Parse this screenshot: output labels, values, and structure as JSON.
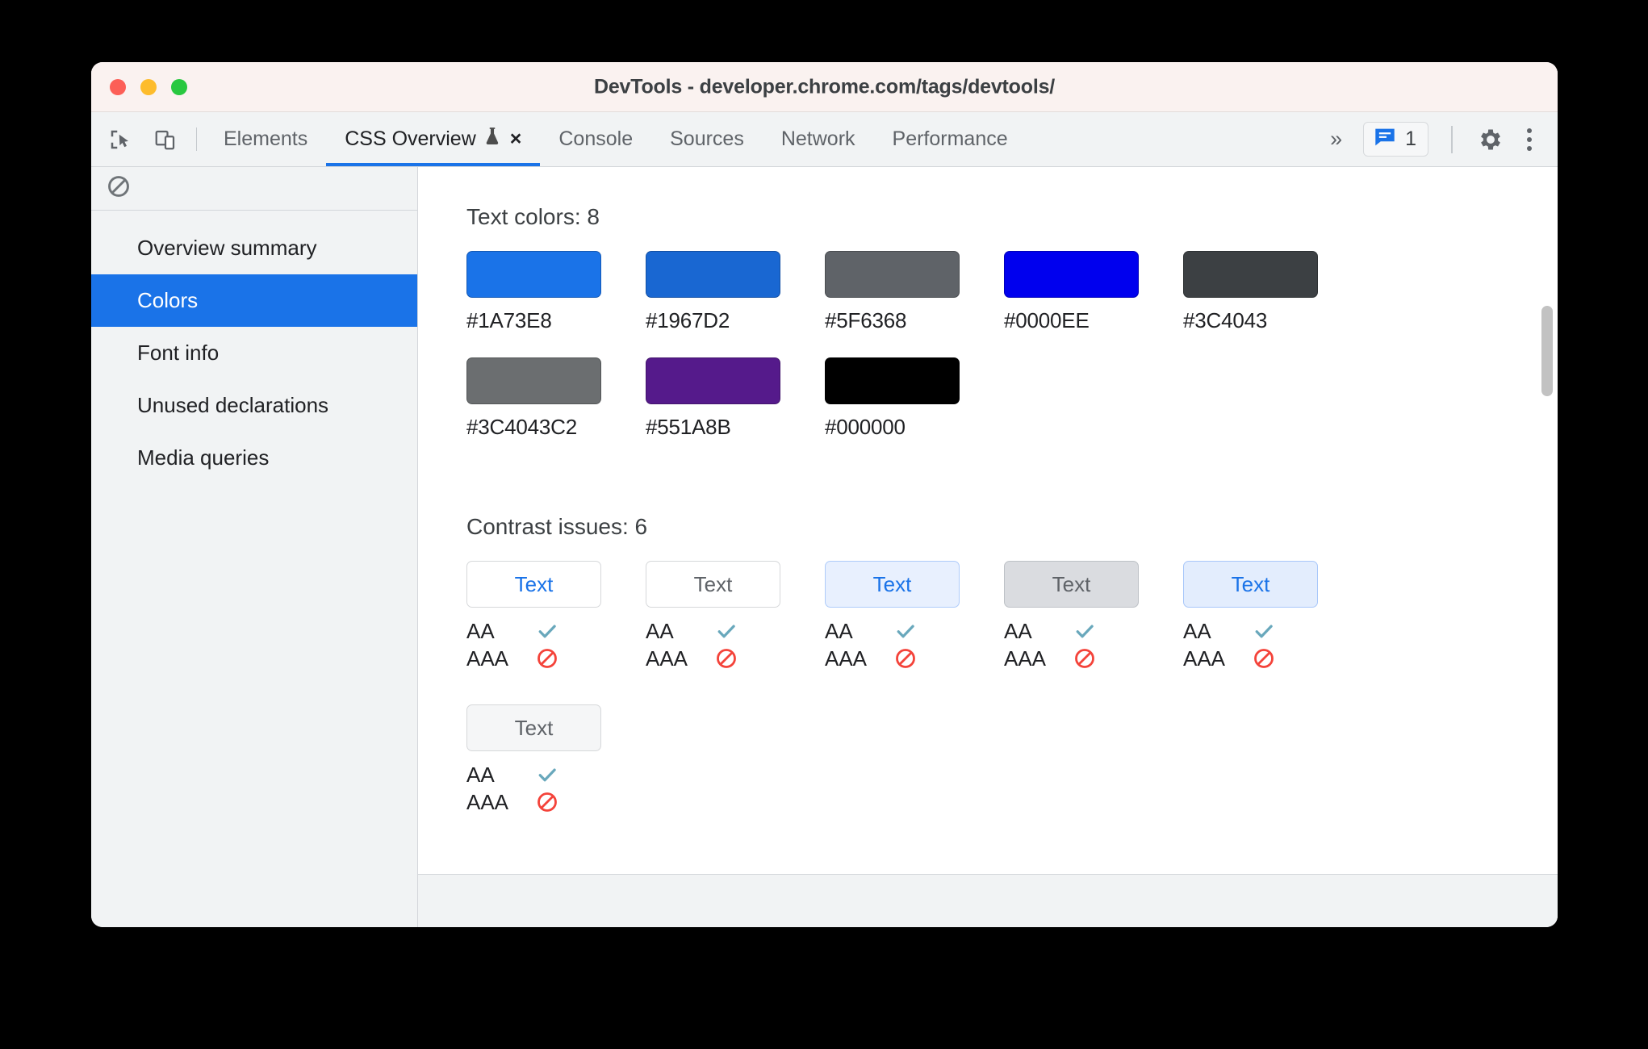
{
  "window": {
    "title": "DevTools - developer.chrome.com/tags/devtools/",
    "traffic_lights": [
      {
        "name": "close",
        "color": "#FC5F57"
      },
      {
        "name": "minimize",
        "color": "#FDBC2C"
      },
      {
        "name": "zoom",
        "color": "#28C840"
      }
    ]
  },
  "toolbar": {
    "inspect_icon": "inspect-element-icon",
    "device_icon": "device-toolbar-icon",
    "tabs": [
      {
        "label": "Elements",
        "active": false,
        "closable": false,
        "experimental": false
      },
      {
        "label": "CSS Overview",
        "active": true,
        "closable": true,
        "experimental": true,
        "close_label": "×"
      },
      {
        "label": "Console",
        "active": false,
        "closable": false,
        "experimental": false
      },
      {
        "label": "Sources",
        "active": false,
        "closable": false,
        "experimental": false
      },
      {
        "label": "Network",
        "active": false,
        "closable": false,
        "experimental": false
      },
      {
        "label": "Performance",
        "active": false,
        "closable": false,
        "experimental": false
      }
    ],
    "overflow_label": "»",
    "issues_count": "1",
    "issues_icon": "issues-message-icon",
    "settings_icon": "gear-icon",
    "menu_icon": "kebab-menu-icon",
    "active_tab_underline_color": "#1A73E8"
  },
  "sidebar": {
    "clear_icon": "clear-overview-icon",
    "items": [
      {
        "label": "Overview summary",
        "selected": false
      },
      {
        "label": "Colors",
        "selected": true
      },
      {
        "label": "Font info",
        "selected": false
      },
      {
        "label": "Unused declarations",
        "selected": false
      },
      {
        "label": "Media queries",
        "selected": false
      }
    ],
    "selected_bg": "#1A73E8"
  },
  "main": {
    "text_colors": {
      "heading": "Text colors: 8",
      "swatches": [
        {
          "label": "#1A73E8",
          "color": "#1A73E8"
        },
        {
          "label": "#1967D2",
          "color": "#1967D2"
        },
        {
          "label": "#5F6368",
          "color": "#5F6368"
        },
        {
          "label": "#0000EE",
          "color": "#0000EE"
        },
        {
          "label": "#3C4043",
          "color": "#3C4043"
        },
        {
          "label": "#3C4043C2",
          "color": "#3C4043C2"
        },
        {
          "label": "#551A8B",
          "color": "#551A8B"
        },
        {
          "label": "#000000",
          "color": "#000000"
        }
      ]
    },
    "contrast_issues": {
      "heading": "Contrast issues: 6",
      "aa_label": "AA",
      "aaa_label": "AAA",
      "pass_icon": "checkmark-icon",
      "fail_icon": "blocked-icon",
      "pass_icon_color": "#69A8BC",
      "fail_icon_color": "#F4433A",
      "cards": [
        {
          "text": "Text",
          "text_color": "#1A73E8",
          "bg": "#FFFFFF",
          "border": "#D6D8DA",
          "aa": "pass",
          "aaa": "fail"
        },
        {
          "text": "Text",
          "text_color": "#5F6368",
          "bg": "#FFFFFF",
          "border": "#D6D8DA",
          "aa": "pass",
          "aaa": "fail"
        },
        {
          "text": "Text",
          "text_color": "#1A73E8",
          "bg": "#E8F0FE",
          "border": "#AECBFA",
          "aa": "pass",
          "aaa": "fail"
        },
        {
          "text": "Text",
          "text_color": "#5F6368",
          "bg": "#DADCE0",
          "border": "#BDC1C6",
          "aa": "pass",
          "aaa": "fail"
        },
        {
          "text": "Text",
          "text_color": "#1A73E8",
          "bg": "#E3EDFD",
          "border": "#A8C7FA",
          "aa": "pass",
          "aaa": "fail"
        },
        {
          "text": "Text",
          "text_color": "#5F6368",
          "bg": "#F5F6F7",
          "border": "#D6D8DA",
          "aa": "pass",
          "aaa": "fail"
        }
      ]
    }
  }
}
